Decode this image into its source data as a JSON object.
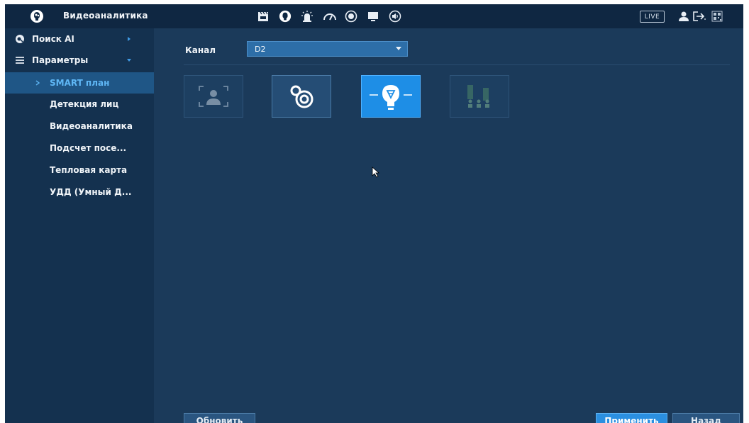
{
  "app": {
    "title": "Видеоаналитика",
    "logo_icon": "brain-head-icon"
  },
  "topbar": {
    "icons": [
      "clapperboard-icon",
      "brain-head-icon",
      "alarm-light-icon",
      "gauge-icon",
      "record-icon",
      "monitor-icon",
      "speaker-icon"
    ],
    "live_label": "LIVE",
    "right_icons": [
      "user-icon",
      "logout-icon",
      "qr-code-icon"
    ]
  },
  "sidebar": {
    "items": [
      {
        "label": "Поиск AI",
        "icon": "ai-search-icon",
        "arrow": "chevron-right-icon"
      },
      {
        "label": "Параметры",
        "icon": "list-icon",
        "arrow": "chevron-down-icon"
      }
    ],
    "sub_items": [
      {
        "label": "SMART план",
        "active": true
      },
      {
        "label": "Детекция лиц",
        "active": false
      },
      {
        "label": "Видеоаналитика",
        "active": false
      },
      {
        "label": "Подсчет посе...",
        "active": false
      },
      {
        "label": "Тепловая карта",
        "active": false
      },
      {
        "label": "УДД (Умный Д...",
        "active": false
      }
    ]
  },
  "channel": {
    "label": "Канал",
    "value": "D2"
  },
  "smart_plans": [
    {
      "icon": "face-detect-icon",
      "state": "disabled"
    },
    {
      "icon": "heatmap-rings-icon",
      "state": "normal"
    },
    {
      "icon": "video-analytics-bulb-icon",
      "state": "selected"
    },
    {
      "icon": "people-counting-icon",
      "state": "disabled"
    }
  ],
  "buttons": {
    "refresh": "Обновить",
    "apply": "Применить",
    "back": "Назад"
  },
  "colors": {
    "background": "#1b3a5a",
    "topbar": "#0f2742",
    "sidebar": "#14314f",
    "accent": "#1e8ee6",
    "active_text": "#5fb7f5"
  }
}
